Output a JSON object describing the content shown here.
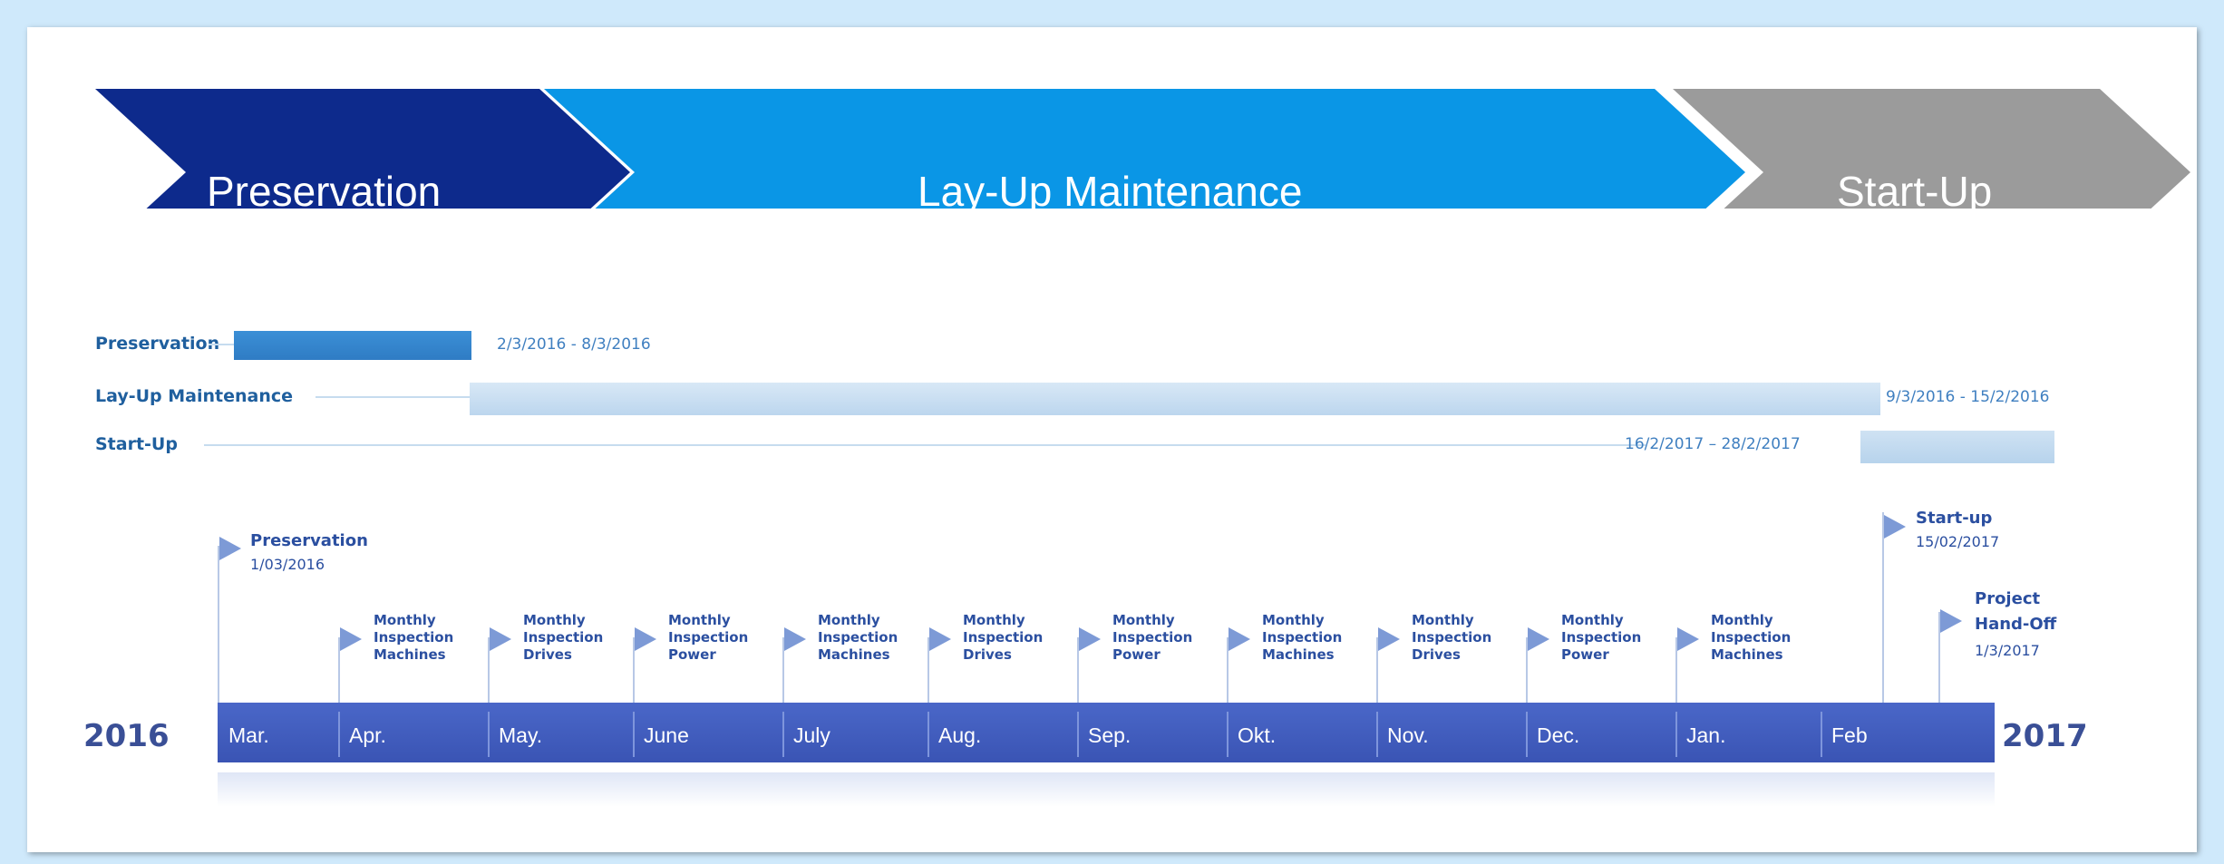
{
  "phases": [
    {
      "label": "Preservation",
      "color": "#0d2a8c"
    },
    {
      "label": "Lay-Up Maintenance",
      "color": "#0a96e6"
    },
    {
      "label": "Start-Up",
      "color": "#9b9b9b"
    }
  ],
  "gantt": [
    {
      "label": "Preservation",
      "dates": "2/3/2016 - 8/3/2016"
    },
    {
      "label": "Lay-Up Maintenance",
      "dates": "9/3/2016 - 15/2/2016"
    },
    {
      "label": "Start-Up",
      "dates": "16/2/2017 – 28/2/2017"
    }
  ],
  "milestones": {
    "preservation": {
      "title": "Preservation",
      "date": "1/03/2016"
    },
    "startup": {
      "title": "Start-up",
      "date": "15/02/2017"
    },
    "handoff": {
      "title1": "Project",
      "title2": "Hand-Off",
      "date": "1/3/2017"
    },
    "monthly": [
      {
        "l1": "Monthly",
        "l2": "Inspection",
        "l3": "Machines"
      },
      {
        "l1": "Monthly",
        "l2": "Inspection",
        "l3": "Drives"
      },
      {
        "l1": "Monthly",
        "l2": "Inspection",
        "l3": "Power"
      },
      {
        "l1": "Monthly",
        "l2": "Inspection",
        "l3": "Machines"
      },
      {
        "l1": "Monthly",
        "l2": "Inspection",
        "l3": "Drives"
      },
      {
        "l1": "Monthly",
        "l2": "Inspection",
        "l3": "Power"
      },
      {
        "l1": "Monthly",
        "l2": "Inspection",
        "l3": "Machines"
      },
      {
        "l1": "Monthly",
        "l2": "Inspection",
        "l3": "Drives"
      },
      {
        "l1": "Monthly",
        "l2": "Inspection",
        "l3": "Power"
      },
      {
        "l1": "Monthly",
        "l2": "Inspection",
        "l3": "Machines"
      }
    ]
  },
  "timeline": {
    "start_year": "2016",
    "end_year": "2017",
    "months": [
      "Mar.",
      "Apr.",
      "May.",
      "June",
      "July",
      "Aug.",
      "Sep.",
      "Okt.",
      "Nov.",
      "Dec.",
      "Jan.",
      "Feb"
    ]
  }
}
